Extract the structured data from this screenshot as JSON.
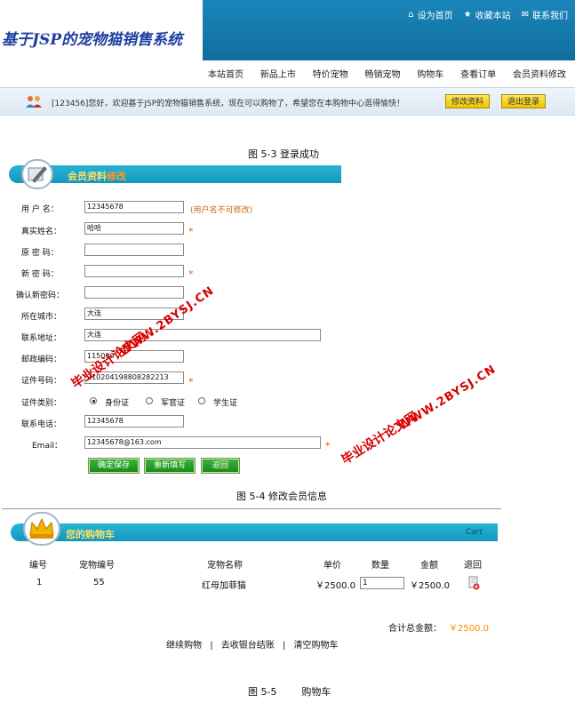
{
  "header": {
    "logo_text": "基于JSP的宠物猫销售系统",
    "top_links": [
      {
        "label": "设为首页",
        "icon": "home-icon"
      },
      {
        "label": "收藏本站",
        "icon": "star-icon"
      },
      {
        "label": "联系我们",
        "icon": "mail-icon"
      }
    ],
    "nav": [
      "本站首页",
      "新品上市",
      "特价宠物",
      "畅销宠物",
      "购物车",
      "查看订单",
      "会员资料修改"
    ]
  },
  "welcome": {
    "text": "[123456]您好，欢迎基于JSP的宠物猫销售系统，现在可以购物了，希望您在本购物中心逛得愉快！",
    "edit_button": "修改资料",
    "logout_button": "退出登录"
  },
  "captions": {
    "fig3": "图 5-3  登录成功",
    "fig4": "图 5-4  修改会员信息",
    "fig5": "图 5-5        购物车"
  },
  "member_form": {
    "title_a": "会员资料",
    "title_b": "修改",
    "username_label": "用 户 名：",
    "username_value": "12345678",
    "username_note": "(用户名不可修改)",
    "realname_label": "真实姓名：",
    "realname_value": "哈哈",
    "oldpwd_label": "原 密 码：",
    "newpwd_label": "新 密 码：",
    "confirm_label": "确认新密码：",
    "city_label": "所在城市：",
    "city_value": "大连",
    "address_label": "联系地址：",
    "address_value": "大连",
    "zip_label": "邮政编码：",
    "zip_value": "115000",
    "idno_label": "证件号码：",
    "idno_value": "210204198808282213",
    "idtype_label": "证件类别：",
    "idtypes": [
      "身份证",
      "军官证",
      "学生证"
    ],
    "phone_label": "联系电话：",
    "phone_value": "12345678",
    "email_label": "Email：",
    "email_value": "12345678@163.com",
    "required_mark": "*",
    "buttons": [
      "确定保存",
      "重新填写",
      "返回"
    ]
  },
  "watermarks": {
    "w1": "毕业设计论文网",
    "w2": "WWW.2BYSJ.CN"
  },
  "cart": {
    "title": "您的购物车",
    "title_en": "Cart",
    "headers": [
      "编号",
      "宠物编号",
      "宠物名称",
      "单价",
      "数量",
      "金额",
      "退回"
    ],
    "row": {
      "no": "1",
      "pet_no": "55",
      "name": "红母加菲猫",
      "price": "￥2500.0",
      "qty": "1",
      "amount": "￥2500.0"
    },
    "total_label": "合计总金额：",
    "total_value": "￥2500.0",
    "links": [
      "继续购物",
      "去收银台结账",
      "清空购物车"
    ],
    "separator": "|"
  },
  "colors": {
    "header_blue": "#1b86ba",
    "section_cyan": "#1fa7cb",
    "button_green": "#1f9a1f",
    "button_yellow": "#f6d21a",
    "required_orange": "#e06000",
    "total_orange": "#ff8a00",
    "watermark_red": "#d80000"
  }
}
